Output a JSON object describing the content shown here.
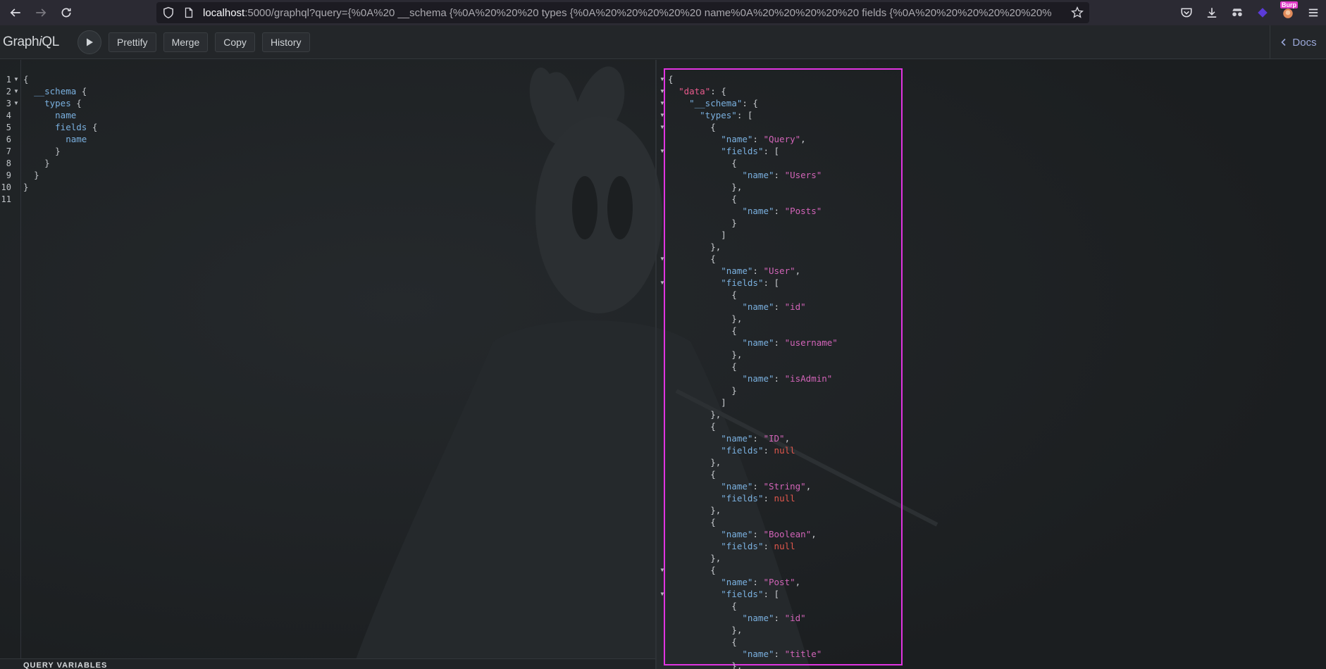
{
  "browser": {
    "url_host": "localhost",
    "url_rest": ":5000/graphql?query={%0A%20 __schema {%0A%20%20%20 types {%0A%20%20%20%20%20 name%0A%20%20%20%20%20 fields {%0A%20%20%20%20%20%20%",
    "extension_badge": "Burp"
  },
  "toolbar": {
    "logo_prefix": "Graph",
    "logo_italic": "i",
    "logo_suffix": "QL",
    "buttons": [
      "Prettify",
      "Merge",
      "Copy",
      "History"
    ],
    "docs_label": "Docs"
  },
  "query_editor": {
    "line_numbers": [
      "1",
      "2",
      "3",
      "4",
      "5",
      "6",
      "7",
      "8",
      "9",
      "10",
      "11"
    ],
    "lines": [
      {
        "indent": "",
        "field": "",
        "punct": "{"
      },
      {
        "indent": "  ",
        "field": "__schema",
        "punct": " {"
      },
      {
        "indent": "    ",
        "field": "types",
        "punct": " {"
      },
      {
        "indent": "      ",
        "field": "name",
        "punct": ""
      },
      {
        "indent": "      ",
        "field": "fields",
        "punct": " {"
      },
      {
        "indent": "        ",
        "field": "name",
        "punct": ""
      },
      {
        "indent": "      ",
        "field": "",
        "punct": "}"
      },
      {
        "indent": "    ",
        "field": "",
        "punct": "}"
      },
      {
        "indent": "  ",
        "field": "",
        "punct": "}"
      },
      {
        "indent": "",
        "field": "",
        "punct": "}"
      },
      {
        "indent": "",
        "field": "",
        "punct": ""
      }
    ]
  },
  "query_variables_label": "QUERY VARIABLES",
  "result": {
    "lines": [
      {
        "t": "{",
        "fold": true
      },
      {
        "t": "  \"data\": {",
        "fold": true,
        "key": "data",
        "top": true
      },
      {
        "t": "    \"__schema\": {",
        "fold": true,
        "key": "__schema"
      },
      {
        "t": "      \"types\": [",
        "fold": true,
        "key": "types"
      },
      {
        "t": "        {",
        "fold": true
      },
      {
        "t": "          \"name\": \"Query\",",
        "key": "name",
        "val": "Query"
      },
      {
        "t": "          \"fields\": [",
        "fold": true,
        "key": "fields"
      },
      {
        "t": "            {"
      },
      {
        "t": "              \"name\": \"Users\"",
        "key": "name",
        "val": "Users"
      },
      {
        "t": "            },"
      },
      {
        "t": "            {"
      },
      {
        "t": "              \"name\": \"Posts\"",
        "key": "name",
        "val": "Posts"
      },
      {
        "t": "            }"
      },
      {
        "t": "          ]"
      },
      {
        "t": "        },"
      },
      {
        "t": "        {",
        "fold": true
      },
      {
        "t": "          \"name\": \"User\",",
        "key": "name",
        "val": "User"
      },
      {
        "t": "          \"fields\": [",
        "fold": true,
        "key": "fields"
      },
      {
        "t": "            {"
      },
      {
        "t": "              \"name\": \"id\"",
        "key": "name",
        "val": "id"
      },
      {
        "t": "            },"
      },
      {
        "t": "            {"
      },
      {
        "t": "              \"name\": \"username\"",
        "key": "name",
        "val": "username"
      },
      {
        "t": "            },"
      },
      {
        "t": "            {"
      },
      {
        "t": "              \"name\": \"isAdmin\"",
        "key": "name",
        "val": "isAdmin"
      },
      {
        "t": "            }"
      },
      {
        "t": "          ]"
      },
      {
        "t": "        },"
      },
      {
        "t": "        {"
      },
      {
        "t": "          \"name\": \"ID\",",
        "key": "name",
        "val": "ID"
      },
      {
        "t": "          \"fields\": null",
        "key": "fields",
        "null": true
      },
      {
        "t": "        },"
      },
      {
        "t": "        {"
      },
      {
        "t": "          \"name\": \"String\",",
        "key": "name",
        "val": "String"
      },
      {
        "t": "          \"fields\": null",
        "key": "fields",
        "null": true
      },
      {
        "t": "        },"
      },
      {
        "t": "        {"
      },
      {
        "t": "          \"name\": \"Boolean\",",
        "key": "name",
        "val": "Boolean"
      },
      {
        "t": "          \"fields\": null",
        "key": "fields",
        "null": true
      },
      {
        "t": "        },"
      },
      {
        "t": "        {",
        "fold": true
      },
      {
        "t": "          \"name\": \"Post\",",
        "key": "name",
        "val": "Post"
      },
      {
        "t": "          \"fields\": [",
        "fold": true,
        "key": "fields"
      },
      {
        "t": "            {"
      },
      {
        "t": "              \"name\": \"id\"",
        "key": "name",
        "val": "id"
      },
      {
        "t": "            },"
      },
      {
        "t": "            {"
      },
      {
        "t": "              \"name\": \"title\"",
        "key": "name",
        "val": "title"
      },
      {
        "t": "            },"
      }
    ]
  },
  "colors": {
    "highlight_border": "#e134e1",
    "field": "#7ab0df",
    "string": "#d264b8",
    "null": "#e2574c"
  }
}
